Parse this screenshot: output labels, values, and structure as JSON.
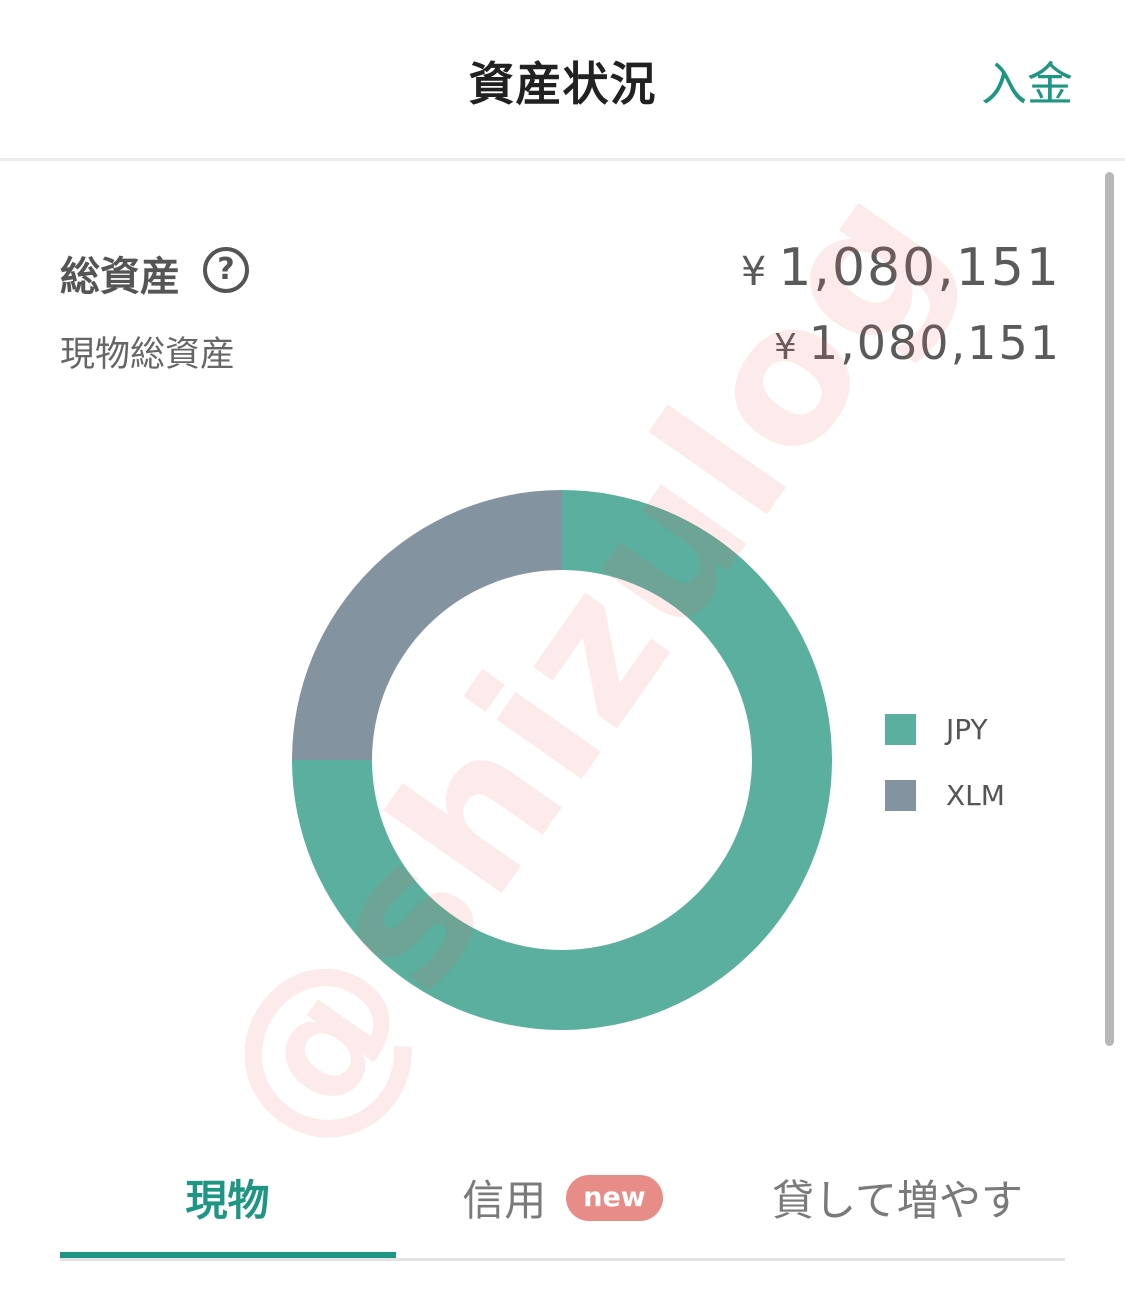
{
  "header": {
    "title": "資産状況",
    "deposit_label": "入金"
  },
  "summary": {
    "total_label": "総資産",
    "help_icon_glyph": "?",
    "currency_symbol": "¥",
    "total_value": "1,080,151",
    "spot_label": "現物総資産",
    "spot_value": "1,080,151"
  },
  "chart_data": {
    "type": "pie",
    "donut": true,
    "categories": [
      "JPY",
      "XLM"
    ],
    "values": [
      75,
      25
    ],
    "colors": [
      "#5aaf9f",
      "#8493a0"
    ],
    "legend_position": "right"
  },
  "legend": {
    "items": [
      {
        "label": "JPY",
        "color": "#5aaf9f"
      },
      {
        "label": "XLM",
        "color": "#8493a0"
      }
    ]
  },
  "watermark": {
    "text": "@shizulog"
  },
  "tabs": [
    {
      "label": "現物",
      "active": true
    },
    {
      "label": "信用",
      "badge": "new"
    },
    {
      "label": "貸して増やす"
    }
  ],
  "colors": {
    "accent": "#1f9583",
    "badge": "#e88c88"
  }
}
